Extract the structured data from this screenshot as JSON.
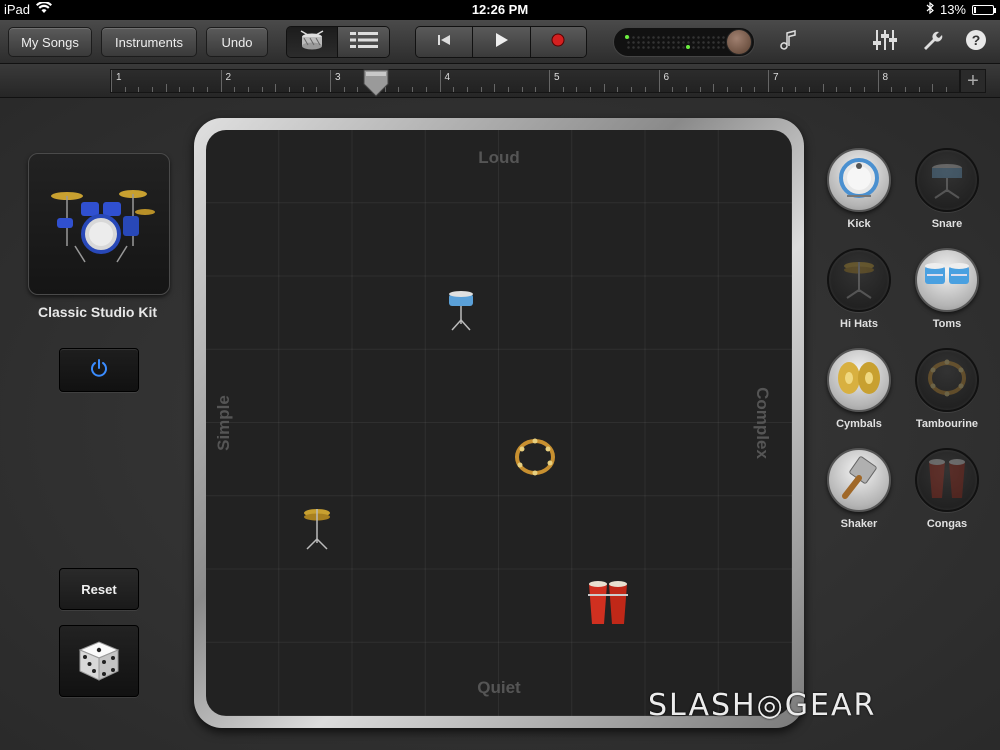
{
  "status_bar": {
    "device": "iPad",
    "time": "12:26 PM",
    "battery": "13%",
    "battery_level": 0.13
  },
  "toolbar": {
    "my_songs": "My Songs",
    "instruments": "Instruments",
    "undo": "Undo"
  },
  "ruler": {
    "bars": [
      "1",
      "2",
      "3",
      "4",
      "5",
      "6",
      "7",
      "8"
    ],
    "add": "+"
  },
  "kit": {
    "name": "Classic Studio Kit"
  },
  "left_controls": {
    "reset": "Reset"
  },
  "pad": {
    "top": "Loud",
    "bottom": "Quiet",
    "left": "Simple",
    "right": "Complex"
  },
  "instruments": [
    {
      "label": "Kick",
      "active": true,
      "icon": "kick-drum-icon"
    },
    {
      "label": "Snare",
      "active": false,
      "icon": "snare-drum-icon"
    },
    {
      "label": "Hi Hats",
      "active": false,
      "icon": "hi-hat-icon"
    },
    {
      "label": "Toms",
      "active": true,
      "icon": "toms-icon"
    },
    {
      "label": "Cymbals",
      "active": true,
      "icon": "cymbals-icon"
    },
    {
      "label": "Tambourine",
      "active": false,
      "icon": "tambourine-icon"
    },
    {
      "label": "Shaker",
      "active": true,
      "icon": "shaker-icon"
    },
    {
      "label": "Congas",
      "active": false,
      "icon": "congas-icon"
    }
  ],
  "watermark": "SLASH◎GEAR",
  "colors": {
    "power_led": "#3a8cff",
    "record": "#d42020",
    "accent_meter": "#6cf040"
  }
}
